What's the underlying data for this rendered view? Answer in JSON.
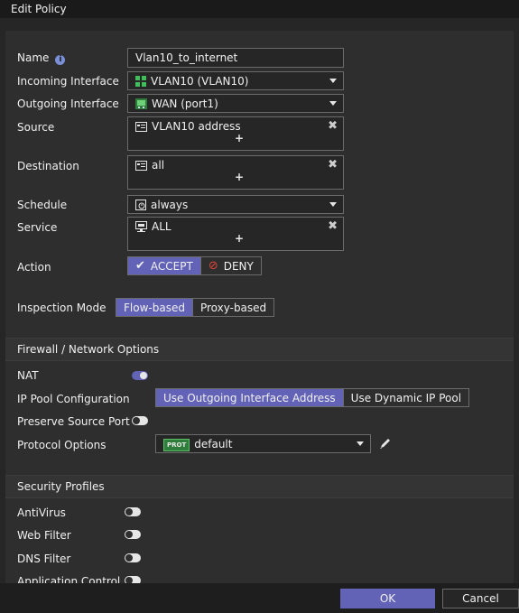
{
  "dialog": {
    "title": "Edit Policy"
  },
  "form": {
    "name": {
      "label": "Name",
      "value": "Vlan10_to_internet"
    },
    "incoming": {
      "label": "Incoming Interface",
      "value": "VLAN10 (VLAN10)"
    },
    "outgoing": {
      "label": "Outgoing Interface",
      "value": "WAN (port1)"
    },
    "source": {
      "label": "Source",
      "value": "VLAN10 address",
      "add": "+"
    },
    "destination": {
      "label": "Destination",
      "value": "all",
      "add": "+"
    },
    "schedule": {
      "label": "Schedule",
      "value": "always"
    },
    "service": {
      "label": "Service",
      "value": "ALL",
      "add": "+"
    },
    "action": {
      "label": "Action",
      "accept": "ACCEPT",
      "deny": "DENY",
      "selected": "ACCEPT"
    },
    "inspection": {
      "label": "Inspection Mode",
      "flow": "Flow-based",
      "proxy": "Proxy-based",
      "selected": "Flow-based"
    }
  },
  "firewall": {
    "title": "Firewall / Network Options",
    "nat": {
      "label": "NAT",
      "enabled": true
    },
    "ippool": {
      "label": "IP Pool Configuration",
      "opt1": "Use Outgoing Interface Address",
      "opt2": "Use Dynamic IP Pool",
      "selected": "Use Outgoing Interface Address"
    },
    "preserve": {
      "label": "Preserve Source Port",
      "enabled": false
    },
    "protocol": {
      "label": "Protocol Options",
      "badge": "PROT",
      "value": "default"
    }
  },
  "security": {
    "title": "Security Profiles",
    "items": [
      {
        "label": "AntiVirus",
        "enabled": false
      },
      {
        "label": "Web Filter",
        "enabled": false
      },
      {
        "label": "DNS Filter",
        "enabled": false
      },
      {
        "label": "Application Control",
        "enabled": false
      }
    ]
  },
  "footer": {
    "ok": "OK",
    "cancel": "Cancel"
  },
  "colors": {
    "accent": "#6262b6",
    "background": "#262626",
    "panel": "#2e2e2e"
  }
}
